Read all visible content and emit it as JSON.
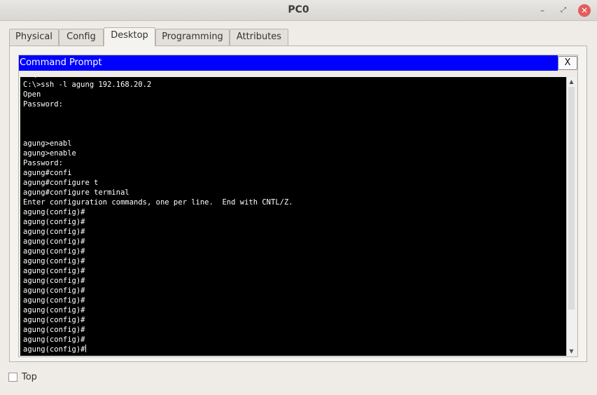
{
  "window": {
    "title": "PC0",
    "minimize_glyph": "–",
    "maximize_glyph": "⤢",
    "close_glyph": "✕"
  },
  "tabs": [
    {
      "label": "Physical",
      "active": false
    },
    {
      "label": "Config",
      "active": false
    },
    {
      "label": "Desktop",
      "active": true
    },
    {
      "label": "Programming",
      "active": false
    },
    {
      "label": "Attributes",
      "active": false
    }
  ],
  "command_prompt": {
    "title": "Command Prompt",
    "close_label": "X",
    "lines": [
      "C:\\>",
      "C:\\>ssh -l agung 192.168.20.2",
      "Open",
      "Password:",
      "",
      "",
      "",
      "agung>enabl",
      "agung>enable",
      "Password:",
      "agung#confi",
      "agung#configure t",
      "agung#configure terminal",
      "Enter configuration commands, one per line.  End with CNTL/Z.",
      "agung(config)#",
      "agung(config)#",
      "agung(config)#",
      "agung(config)#",
      "agung(config)#",
      "agung(config)#",
      "agung(config)#",
      "agung(config)#",
      "agung(config)#",
      "agung(config)#",
      "agung(config)#",
      "agung(config)#",
      "agung(config)#",
      "agung(config)#",
      "agung(config)#"
    ]
  },
  "footer": {
    "top_label": "Top",
    "top_checked": false
  },
  "colors": {
    "prompt_header": "#0000ff",
    "terminal_bg": "#000000",
    "terminal_fg": "#ffffff"
  }
}
